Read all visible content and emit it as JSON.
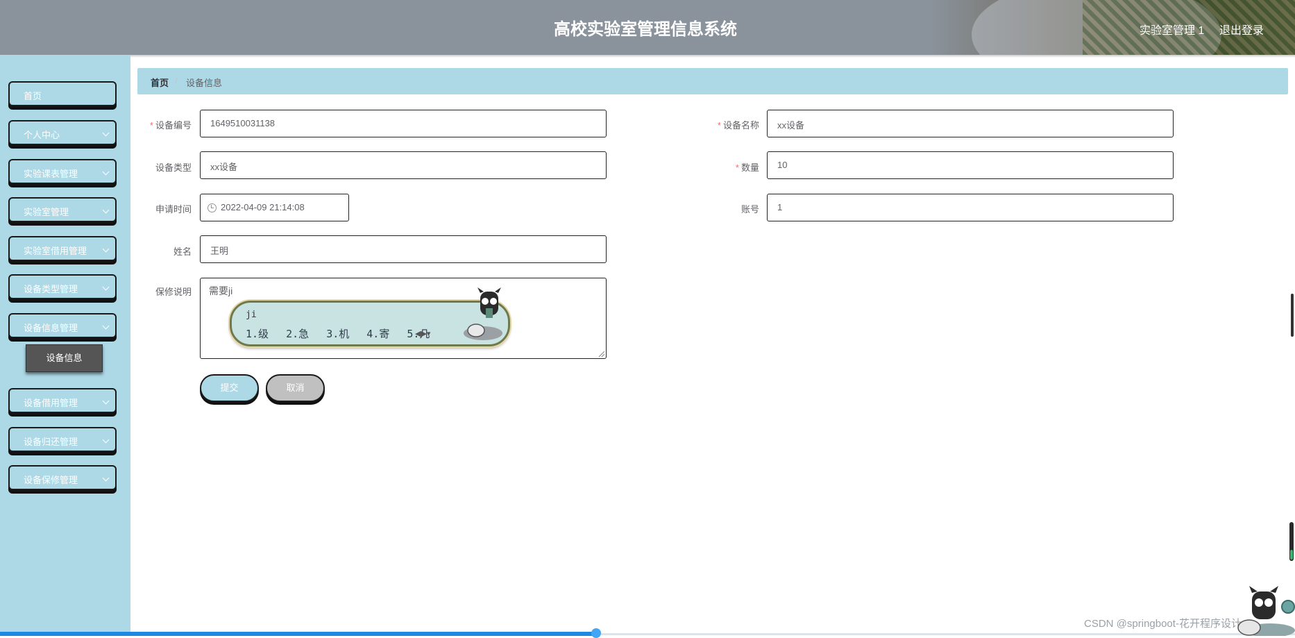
{
  "header": {
    "title": "高校实验室管理信息系统",
    "user": "实验室管理 1",
    "logout": "退出登录"
  },
  "sidebar": {
    "items": [
      {
        "label": "首页",
        "has_chevron": false
      },
      {
        "label": "个人中心",
        "has_chevron": true
      },
      {
        "label": "实验课表管理",
        "has_chevron": true
      },
      {
        "label": "实验室管理",
        "has_chevron": true
      },
      {
        "label": "实验室借用管理",
        "has_chevron": true
      },
      {
        "label": "设备类型管理",
        "has_chevron": true
      },
      {
        "label": "设备信息管理",
        "has_chevron": true
      },
      {
        "label": "设备借用管理",
        "has_chevron": true
      },
      {
        "label": "设备归还管理",
        "has_chevron": true
      },
      {
        "label": "设备保修管理",
        "has_chevron": true
      }
    ],
    "sub_item": "设备信息"
  },
  "breadcrumb": {
    "home": "首页",
    "separator": "/",
    "current": "设备信息"
  },
  "form": {
    "device_no": {
      "label": "设备编号",
      "required": true,
      "value": "1649510031138"
    },
    "device_name": {
      "label": "设备名称",
      "required": true,
      "value": "xx设备"
    },
    "device_type": {
      "label": "设备类型",
      "required": false,
      "value": "xx设备"
    },
    "quantity": {
      "label": "数量",
      "required": true,
      "value": "10"
    },
    "apply_time": {
      "label": "申请时间",
      "required": false,
      "value": "2022-04-09 21:14:08"
    },
    "account": {
      "label": "账号",
      "required": false,
      "value": "1"
    },
    "name": {
      "label": "姓名",
      "required": false,
      "value": "王明"
    },
    "repair_note": {
      "label": "保修说明",
      "required": false,
      "value": "需要ji"
    },
    "required_mark": "*"
  },
  "ime": {
    "composition": "ji",
    "candidates": [
      "1.级",
      "2.急",
      "3.机",
      "4.寄",
      "5.几"
    ]
  },
  "buttons": {
    "submit": "提交",
    "cancel": "取消"
  },
  "watermark": "CSDN @springboot-花开程序设计",
  "colors": {
    "accent": "#add8e6",
    "header_bg": "#8a929b",
    "active_sub_item": "#555555",
    "cancel_button": "#c0c0c0",
    "required": "#f56c6c"
  },
  "icons": {
    "date_picker": "clock-icon",
    "submenu_toggle": "chevron-down-icon"
  }
}
